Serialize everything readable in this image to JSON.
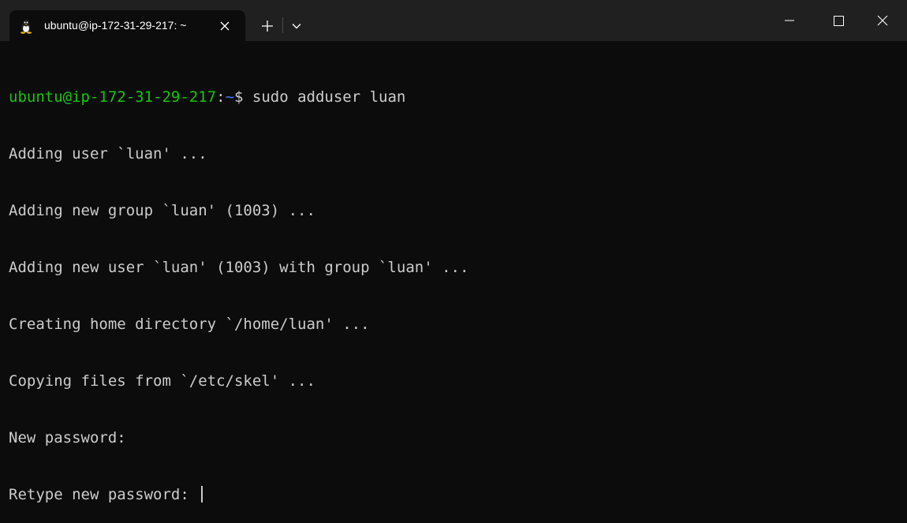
{
  "tab": {
    "title": "ubuntu@ip-172-31-29-217: ~",
    "icon": "linux-tux-icon"
  },
  "titlebar": {
    "new_tab_icon": "plus-icon",
    "dropdown_icon": "chevron-down-icon",
    "minimize_icon": "minimize-icon",
    "maximize_icon": "maximize-icon",
    "close_icon": "close-icon"
  },
  "colors": {
    "background": "#0c0c0c",
    "titlebar": "#202020",
    "text": "#cccccc",
    "prompt_user": "#16c60c",
    "prompt_path": "#3b78ff"
  },
  "terminal": {
    "prompt": {
      "user_host": "ubuntu@ip-172-31-29-217",
      "colon": ":",
      "path": "~",
      "symbol": "$",
      "command": " sudo adduser luan"
    },
    "output": [
      "Adding user `luan' ...",
      "Adding new group `luan' (1003) ...",
      "Adding new user `luan' (1003) with group `luan' ...",
      "Creating home directory `/home/luan' ...",
      "Copying files from `/etc/skel' ...",
      "New password:"
    ],
    "current_line": "Retype new password: "
  }
}
